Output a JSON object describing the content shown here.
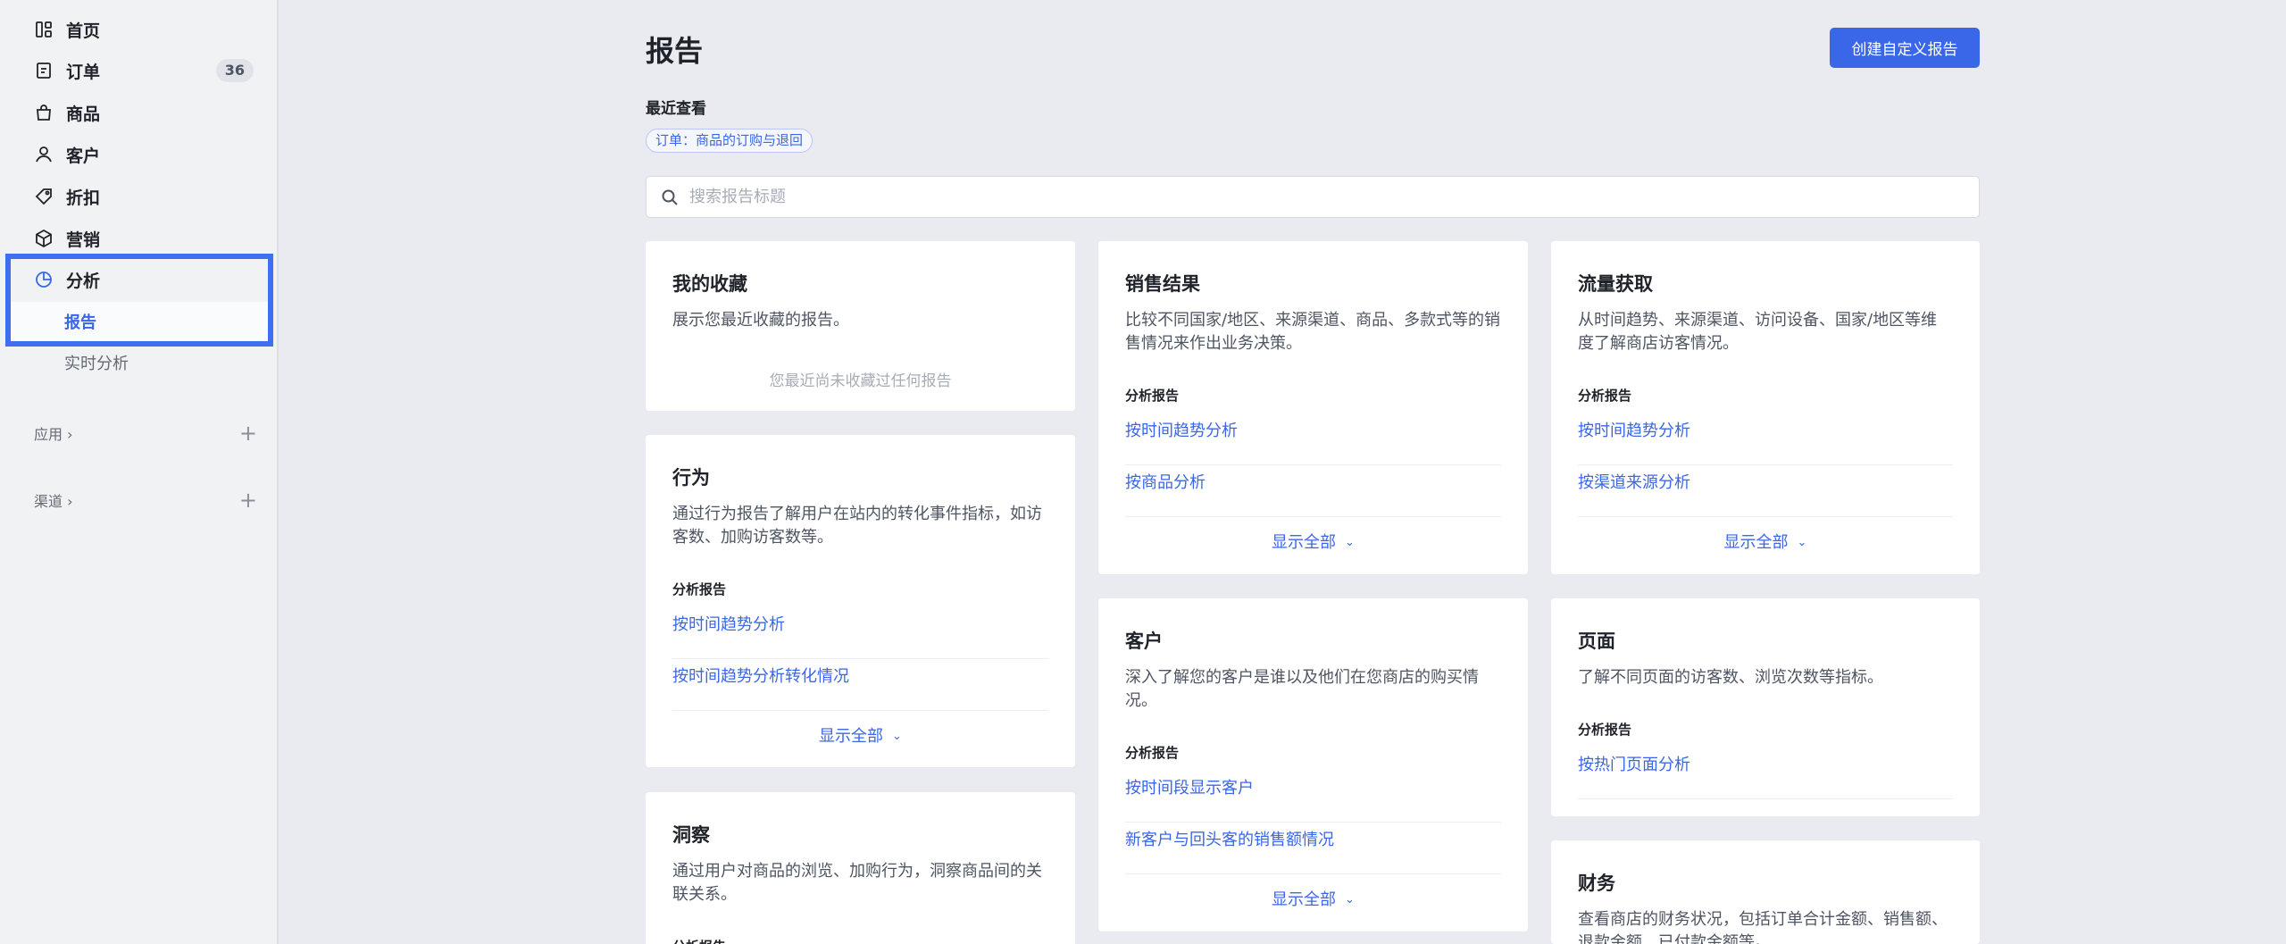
{
  "sidebar": {
    "items": [
      {
        "label": "首页",
        "icon": "home-icon"
      },
      {
        "label": "订单",
        "icon": "order-icon",
        "badge": "36"
      },
      {
        "label": "商品",
        "icon": "product-icon"
      },
      {
        "label": "客户",
        "icon": "customer-icon"
      },
      {
        "label": "折扣",
        "icon": "discount-icon"
      },
      {
        "label": "营销",
        "icon": "marketing-icon"
      },
      {
        "label": "分析",
        "icon": "analytics-icon"
      }
    ],
    "sub_items": [
      {
        "label": "报告"
      },
      {
        "label": "实时分析"
      }
    ],
    "groups": [
      {
        "label": "应用 ›"
      },
      {
        "label": "渠道 ›"
      }
    ]
  },
  "header": {
    "title": "报告",
    "create_button": "创建自定义报告"
  },
  "recent": {
    "title": "最近查看",
    "chip": "订单：商品的订购与退回"
  },
  "search": {
    "placeholder": "搜索报告标题"
  },
  "cards": {
    "favorites": {
      "title": "我的收藏",
      "desc": "展示您最近收藏的报告。",
      "empty": "您最近尚未收藏过任何报告"
    },
    "behavior": {
      "title": "行为",
      "desc": "通过行为报告了解用户在站内的转化事件指标，如访客数、加购访客数等。",
      "section": "分析报告",
      "links": [
        "按时间趋势分析",
        "按时间趋势分析转化情况"
      ],
      "show_all": "显示全部"
    },
    "insight": {
      "title": "洞察",
      "desc": "通过用户对商品的浏览、加购行为，洞察商品间的关联关系。",
      "section": "分析报告"
    },
    "sales": {
      "title": "销售结果",
      "desc": "比较不同国家/地区、来源渠道、商品、多款式等的销售情况来作出业务决策。",
      "section": "分析报告",
      "links": [
        "按时间趋势分析",
        "按商品分析"
      ],
      "show_all": "显示全部"
    },
    "customer": {
      "title": "客户",
      "desc": "深入了解您的客户是谁以及他们在您商店的购买情况。",
      "section": "分析报告",
      "links": [
        "按时间段显示客户",
        "新客户与回头客的销售额情况"
      ],
      "show_all": "显示全部"
    },
    "traffic": {
      "title": "流量获取",
      "desc": "从时间趋势、来源渠道、访问设备、国家/地区等维度了解商店访客情况。",
      "section": "分析报告",
      "links": [
        "按时间趋势分析",
        "按渠道来源分析"
      ],
      "show_all": "显示全部"
    },
    "pages": {
      "title": "页面",
      "desc": "了解不同页面的访客数、浏览次数等指标。",
      "section": "分析报告",
      "links": [
        "按热门页面分析"
      ]
    },
    "finance": {
      "title": "财务",
      "desc": "查看商店的财务状况，包括订单合计金额、销售额、退款金额、已付款金额等。"
    }
  }
}
